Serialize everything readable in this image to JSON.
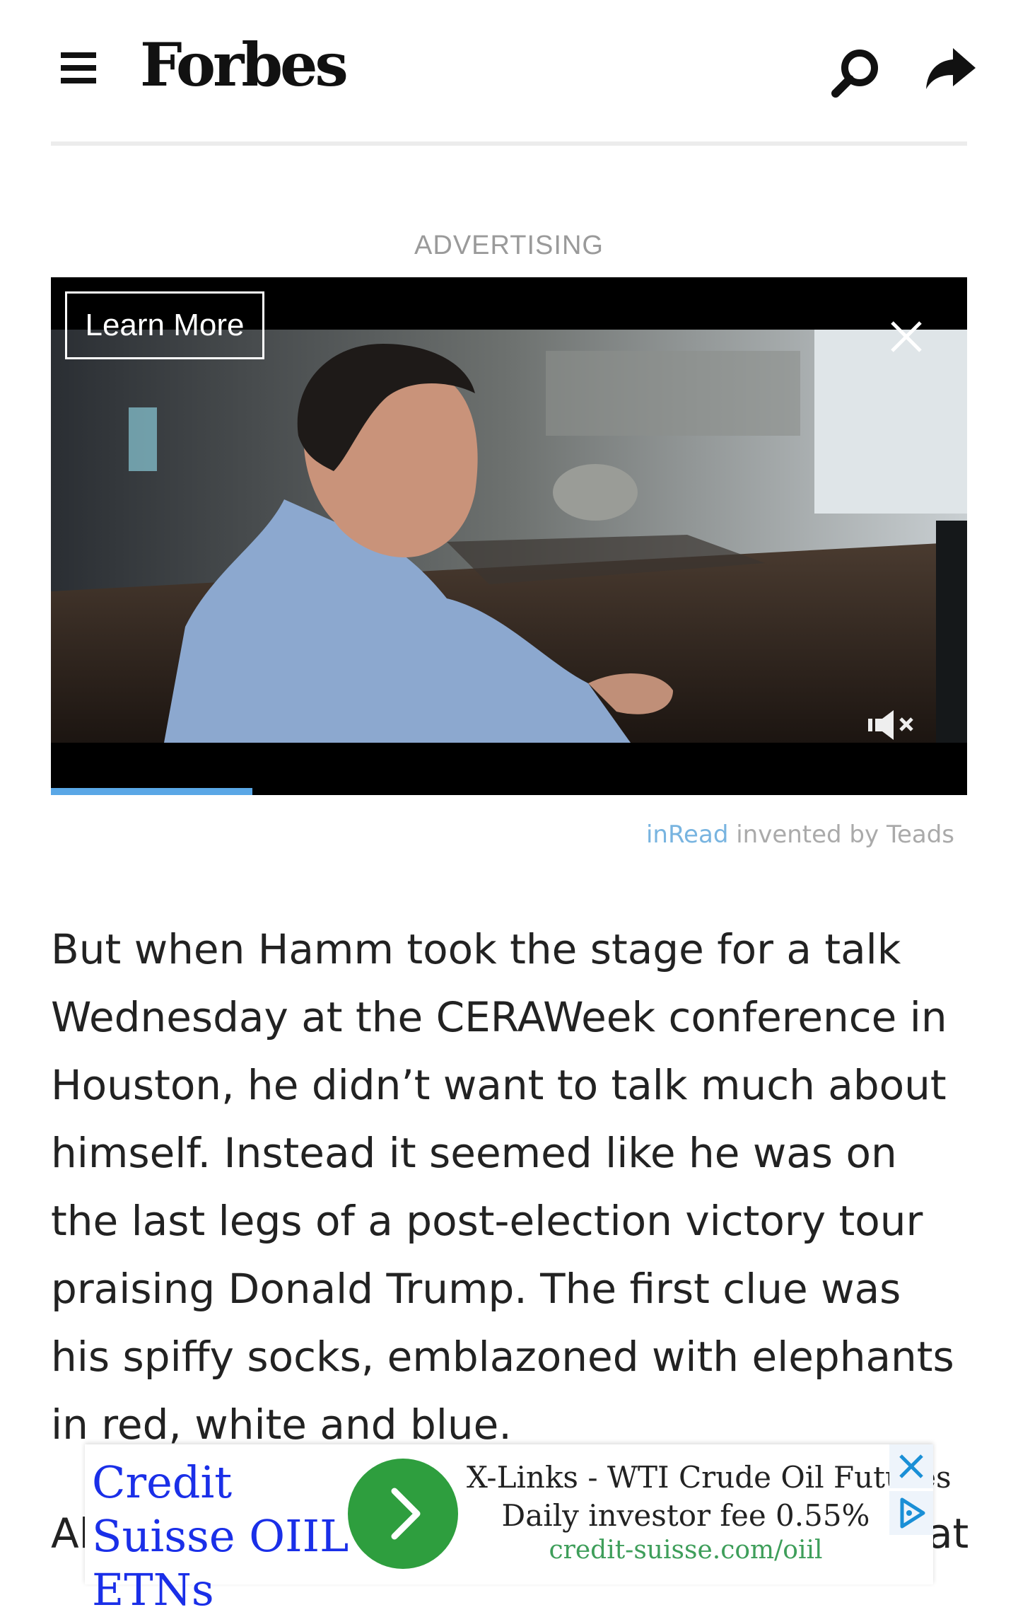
{
  "header": {
    "logo": "Forbes",
    "menu_icon": "hamburger-menu-icon",
    "search_icon": "search-icon",
    "share_icon": "share-icon"
  },
  "advertising": {
    "label": "ADVERTISING",
    "learn_more": "Learn More",
    "progress_fraction": 0.22,
    "attribution_brand": "inRead",
    "attribution_text": " invented by Teads"
  },
  "article": {
    "paragraph_1": "But when Hamm took the stage for a talk Wednesday at the CERAWeek conference in Houston, he didn’t want to talk much about himself. Instead it seemed like he was on the last legs of a post-election victory tour praising Donald Trump. The first clue was his spiffy socks, emblazoned with elephants in red, white and blue.",
    "paragraph_2_start": "Al",
    "paragraph_2_end": "at"
  },
  "bottom_ad": {
    "title": "Credit Suisse OIIL ETNs",
    "headline": "X-Links - WTI Crude Oil Futures",
    "fee": "Daily investor fee 0.55%",
    "url": "credit-suisse.com/oiil",
    "colors": {
      "title": "#1a2fe8",
      "button": "#2e9e3e",
      "url": "#3e9e5a"
    }
  }
}
